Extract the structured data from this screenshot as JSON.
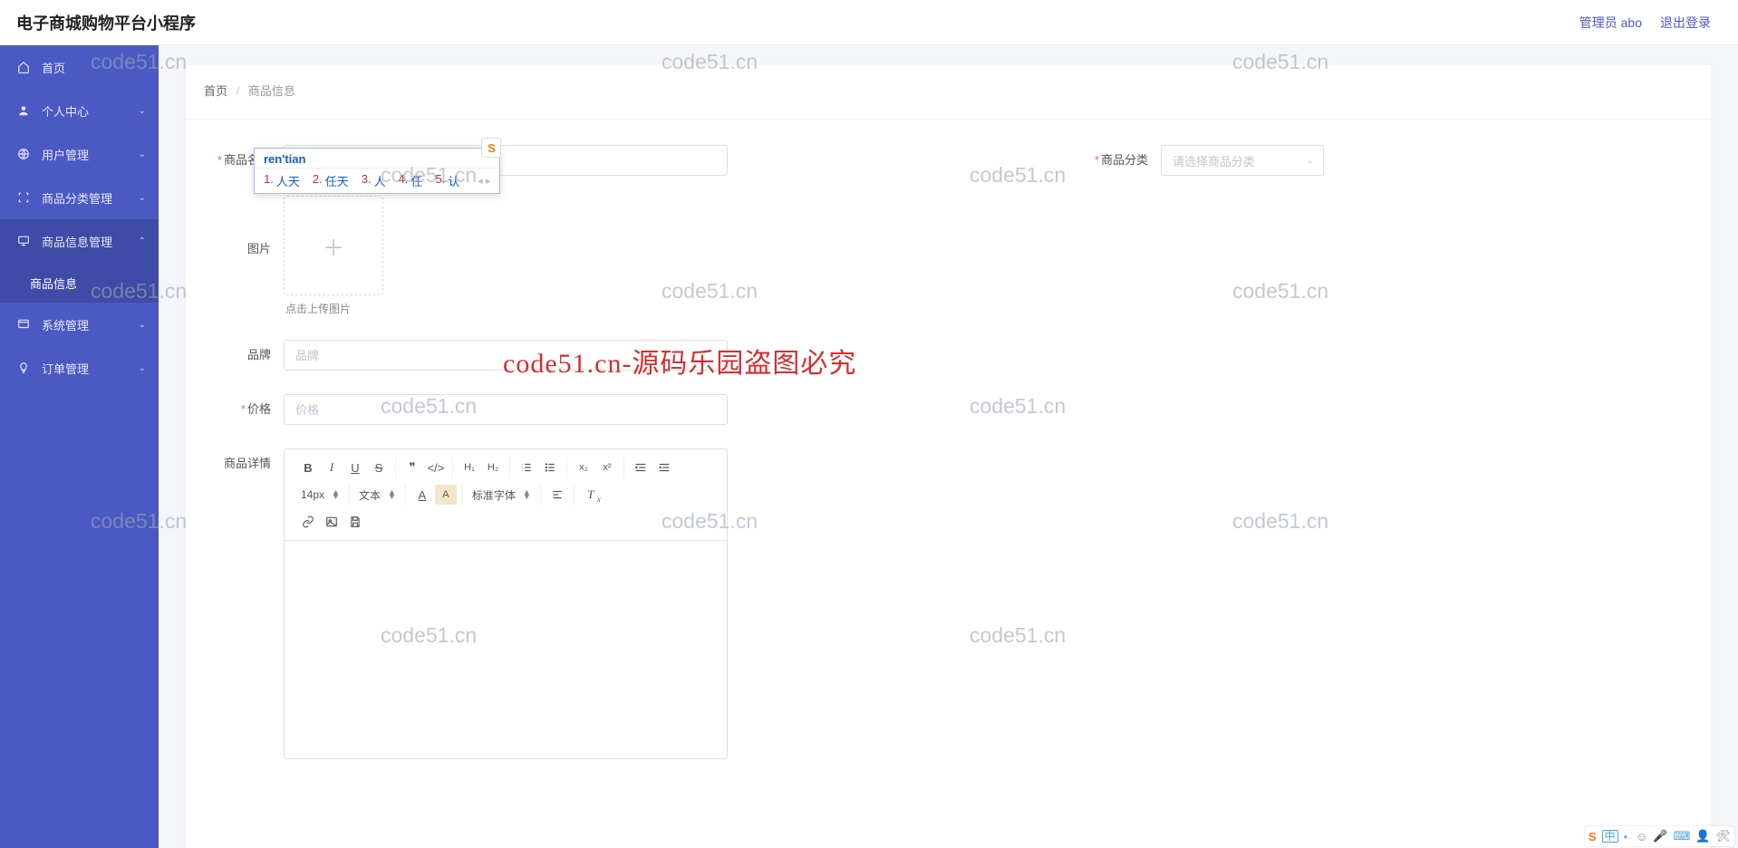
{
  "header": {
    "title": "电子商城购物平台小程序",
    "admin_label": "管理员 abo",
    "logout_label": "退出登录"
  },
  "sidebar": {
    "items": [
      {
        "label": "首页",
        "icon": "home-icon",
        "expandable": false
      },
      {
        "label": "个人中心",
        "icon": "user-icon",
        "expandable": true
      },
      {
        "label": "用户管理",
        "icon": "globe-icon",
        "expandable": true
      },
      {
        "label": "商品分类管理",
        "icon": "bracket-icon",
        "expandable": true
      },
      {
        "label": "商品信息管理",
        "icon": "monitor-icon",
        "expandable": true,
        "expanded": true,
        "children": [
          {
            "label": "商品信息",
            "selected": true
          }
        ]
      },
      {
        "label": "系统管理",
        "icon": "window-icon",
        "expandable": true
      },
      {
        "label": "订单管理",
        "icon": "bulb-icon",
        "expandable": true
      }
    ]
  },
  "breadcrumb": {
    "root": "首页",
    "current": "商品信息"
  },
  "form": {
    "product_name": {
      "label": "商品名称",
      "required": true,
      "value": "rentian"
    },
    "category": {
      "label": "商品分类",
      "required": true,
      "placeholder": "请选择商品分类"
    },
    "image": {
      "label": "图片",
      "hint": "点击上传图片"
    },
    "brand": {
      "label": "品牌",
      "placeholder": "品牌"
    },
    "price": {
      "label": "价格",
      "required": true,
      "placeholder": "价格"
    },
    "detail": {
      "label": "商品详情"
    }
  },
  "editor_toolbar": {
    "font_size": "14px",
    "font_type": "文本",
    "font_family": "标准字体"
  },
  "ime": {
    "composition": "ren'tian",
    "candidates": [
      "人天",
      "任天",
      "人",
      "任",
      "认"
    ]
  },
  "watermarks": {
    "wm": "code51.cn",
    "center": "code51.cn-源码乐园盗图必究"
  }
}
